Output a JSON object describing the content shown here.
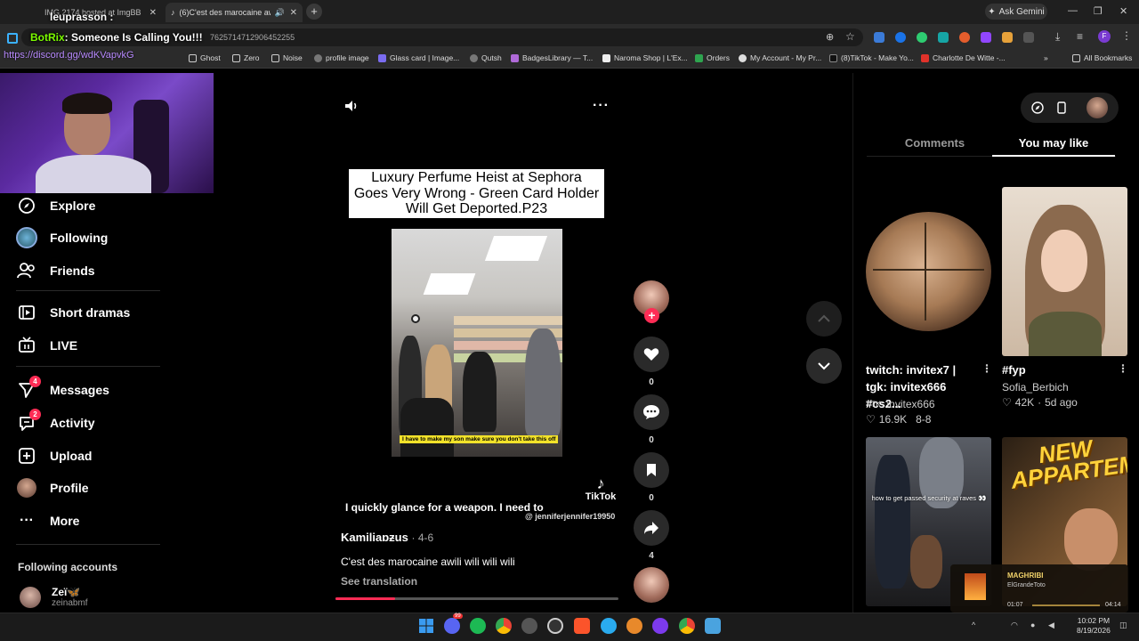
{
  "browser": {
    "tabs": [
      {
        "label": "IMG 2174 hosted at ImgBB",
        "active": false
      },
      {
        "label": "(6)C'est des marocaine awili",
        "active": true
      }
    ],
    "url_fragment": "7625714712906452255",
    "ask_gemini": "Ask Gemini",
    "bookmarks": [
      "Ghost",
      "Zero",
      "Noise",
      "profile image",
      "Glass card | Image...",
      "Qutsh",
      "BadgesLibrary — T...",
      "Naroma Shop | L'Ex...",
      "Orders",
      "My Account - My Pr...",
      "(8)TikTok - Make Yo...",
      "Charlotte De Witte -..."
    ],
    "all_bookmarks": "All Bookmarks"
  },
  "overlay": {
    "viewer_name": "leuprasson :",
    "botrix_name": "BotRix",
    "botrix_msg": ": Someone Is Calling You!!!",
    "discord_link": "https://discord.gg/wdKVapvkG"
  },
  "sidebar": {
    "items": [
      {
        "label": "Explore",
        "icon": "compass-icon"
      },
      {
        "label": "Following",
        "icon": "following-avatar-icon"
      },
      {
        "label": "Friends",
        "icon": "friends-icon"
      },
      {
        "label": "Short dramas",
        "icon": "film-icon"
      },
      {
        "label": "LIVE",
        "icon": "live-tv-icon"
      },
      {
        "label": "Messages",
        "icon": "send-icon",
        "badge": "4"
      },
      {
        "label": "Activity",
        "icon": "activity-icon",
        "badge": "2"
      },
      {
        "label": "Upload",
        "icon": "plus-box-icon"
      },
      {
        "label": "Profile",
        "icon": "profile-avatar-icon"
      },
      {
        "label": "More",
        "icon": "more-dots-icon"
      }
    ],
    "following_header": "Following accounts",
    "account": {
      "name": "Zeï🦋",
      "handle": "zeinabmf"
    }
  },
  "video": {
    "title": "Luxury Perfume Heist at Sephora Goes Very Wrong - Green Card Holder Will Get Deported.P23",
    "in_video_caption": "I have to make my son make sure you don't take this off",
    "subtitle": "I quickly glance for a weapon. I need to",
    "watermark": "TikTok",
    "watermark_handle": "@ jenniferjennifer19950",
    "author": "Kamiliaɒƶus",
    "date": "· 4-6",
    "description": "C'est des marocaine awili wili wili wili",
    "see_translation": "See translation",
    "progress": 0.21
  },
  "actions": {
    "likes": "0",
    "comments": "0",
    "saves": "0",
    "shares": "4"
  },
  "right_panel": {
    "tab_comments": "Comments",
    "tab_you_may_like": "You may like",
    "cards": [
      {
        "title": "twitch: invitex7 | tgk: invitex666 #cs2...",
        "author_prefix": "TTK:",
        "author": "invitex666",
        "likes": "16.9K",
        "date": "8-8"
      },
      {
        "title": "#fyp",
        "author": "Sofia_Berbich",
        "likes": "42K",
        "date": "5d ago"
      },
      {
        "overlay_text": "how to get passed security at raves 👀"
      },
      {
        "overlay_text": "NEW APPARTEMENT"
      }
    ],
    "mini_player": {
      "title": "MAGHRIBI",
      "artist": "ElGrandeToto",
      "time_current": "01:07",
      "time_total": "04:14"
    }
  },
  "taskbar": {
    "time": "10:02 PM",
    "date": "8/19/2026",
    "discord_badge": "99"
  }
}
